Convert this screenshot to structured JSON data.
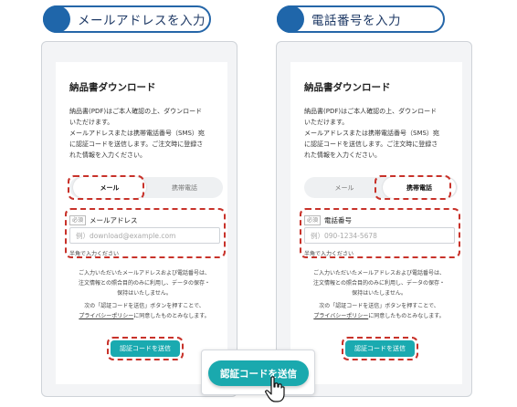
{
  "headers": {
    "left": "メールアドレスを入力",
    "right": "電話番号を入力"
  },
  "left_card": {
    "title": "納品書ダウンロード",
    "desc_lines": [
      "納品書(PDF)はご本人確認の上、ダウンロード",
      "いただけます。",
      "メールアドレスまたは携帯電話番号（SMS）宛",
      "に認証コードを送信します。ご注文時に登録さ",
      "れた情報を入力ください。"
    ],
    "tab_mail": "メール",
    "tab_phone": "携帯電話",
    "required": "必須",
    "field_label": "メールアドレス",
    "placeholder": "例）download@example.com",
    "hint": "半角で入力ください",
    "notice_lines": [
      "ご入力いただいたメールアドレスおよび電話番号は、",
      "注文情報との照合目的のみに利用し、データの保存・",
      "保持はいたしません。"
    ],
    "notice2_line1": "次の「認証コードを送信」ボタンを押すことで、",
    "privacy_link": "プライバシーポリシー",
    "notice2_rest": "に同意したものとみなします。",
    "button": "認証コードを送信"
  },
  "right_card": {
    "title": "納品書ダウンロード",
    "desc_lines": [
      "納品書(PDF)はご本人確認の上、ダウンロード",
      "いただけます。",
      "メールアドレスまたは携帯電話番号（SMS）宛",
      "に認証コードを送信します。ご注文時に登録さ",
      "れた情報を入力ください。"
    ],
    "tab_mail": "メール",
    "tab_phone": "携帯電話",
    "required": "必須",
    "field_label": "電話番号",
    "placeholder": "例）090-1234-5678",
    "hint": "半角で入力ください",
    "notice_lines": [
      "ご入力いただいたメールアドレスおよび電話番号は、",
      "注文情報との照合目的のみに利用し、データの保存・",
      "保持はいたしません。"
    ],
    "notice2_line1": "次の「認証コードを送信」ボタンを押すことで、",
    "privacy_link": "プライバシーポリシー",
    "notice2_rest": "に同意したものとみなします。",
    "button": "認証コードを送信"
  },
  "big_button": "認証コードを送信",
  "colors": {
    "accent": "#1aa9ae",
    "header_blue": "#1f66aa",
    "highlight": "#c8322a"
  }
}
